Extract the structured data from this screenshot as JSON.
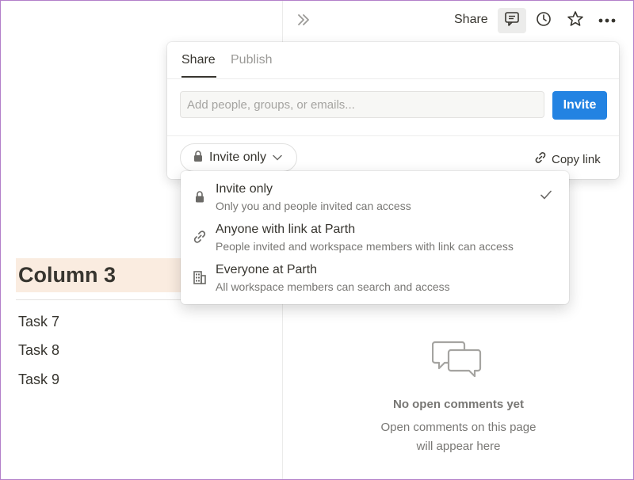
{
  "left": {
    "column_title": "Column 3",
    "tasks": [
      "Task 7",
      "Task 8",
      "Task 9"
    ]
  },
  "topbar": {
    "share_label": "Share",
    "icons": [
      "double-chevron-right-icon",
      "comment-icon",
      "clock-icon",
      "star-icon",
      "more-icon"
    ]
  },
  "share_popover": {
    "tabs": [
      {
        "label": "Share",
        "active": true
      },
      {
        "label": "Publish",
        "active": false
      }
    ],
    "invite_placeholder": "Add people, groups, or emails...",
    "invite_button": "Invite",
    "access_label": "Invite only",
    "copy_link_label": "Copy link"
  },
  "access_menu": {
    "options": [
      {
        "title": "Invite only",
        "description": "Only you and people invited can access",
        "icon": "lock-icon",
        "selected": true
      },
      {
        "title": "Anyone with link at Parth",
        "description": "People invited and workspace members with link can access",
        "icon": "link-icon",
        "selected": false
      },
      {
        "title": "Everyone at Parth",
        "description": "All workspace members can search and access",
        "icon": "building-icon",
        "selected": false
      }
    ]
  },
  "comments": {
    "empty_title": "No open comments yet",
    "empty_subtitle_line1": "Open comments on this page",
    "empty_subtitle_line2": "will appear here"
  },
  "colors": {
    "accent": "#2383e2",
    "column_header_bg": "#faece0",
    "text": "#37352f",
    "muted": "#787774"
  }
}
